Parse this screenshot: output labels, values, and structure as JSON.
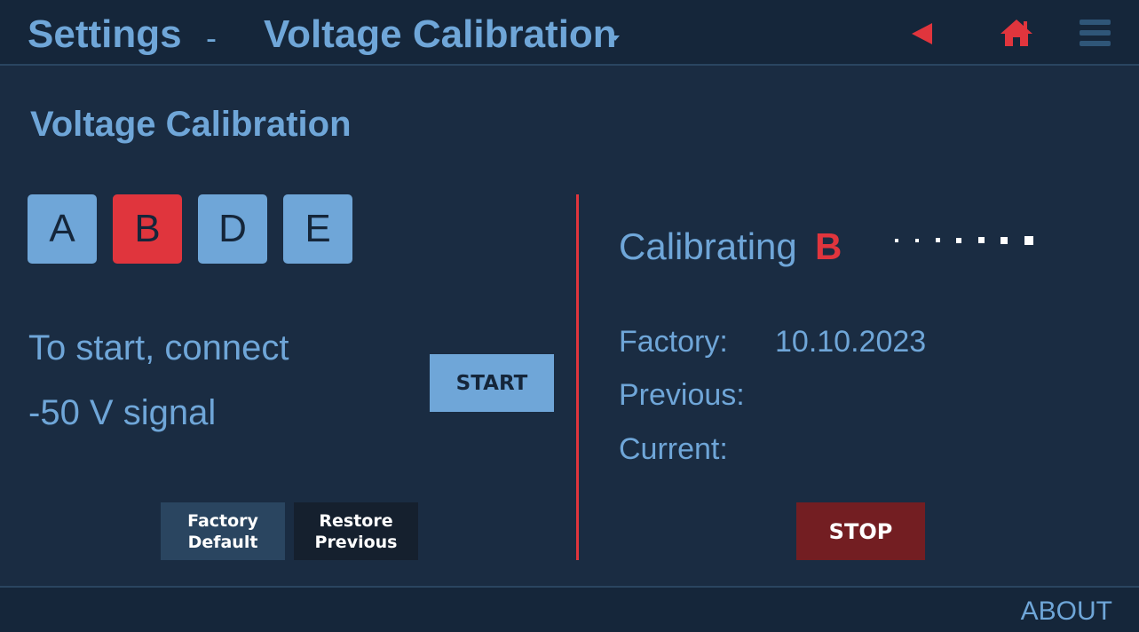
{
  "header": {
    "section": "Settings",
    "separator": "-",
    "page": "Voltage Calibration",
    "icons": [
      "back-icon",
      "home-icon",
      "menu-icon"
    ]
  },
  "main": {
    "title": "Voltage Calibration",
    "channels": [
      {
        "label": "A",
        "active": false
      },
      {
        "label": "B",
        "active": true
      },
      {
        "label": "D",
        "active": false
      },
      {
        "label": "E",
        "active": false
      }
    ],
    "instruction_line1": "To start, connect",
    "instruction_line2": "-50 V signal",
    "start_label": "START",
    "factory_default_line1": "Factory",
    "factory_default_line2": "Default",
    "restore_previous_line1": "Restore",
    "restore_previous_line2": "Previous"
  },
  "status": {
    "calibrating_label": "Calibrating",
    "channel": "B",
    "factory_label": "Factory:",
    "factory_value": "10.10.2023",
    "previous_label": "Previous:",
    "previous_value": "",
    "current_label": "Current:",
    "current_value": "",
    "stop_label": "STOP"
  },
  "footer": {
    "about_label": "ABOUT"
  },
  "colors": {
    "background": "#1a2c42",
    "bar": "#15263a",
    "accent_blue": "#6fa6d8",
    "accent_red": "#e0353d",
    "stop_red": "#731e22"
  }
}
